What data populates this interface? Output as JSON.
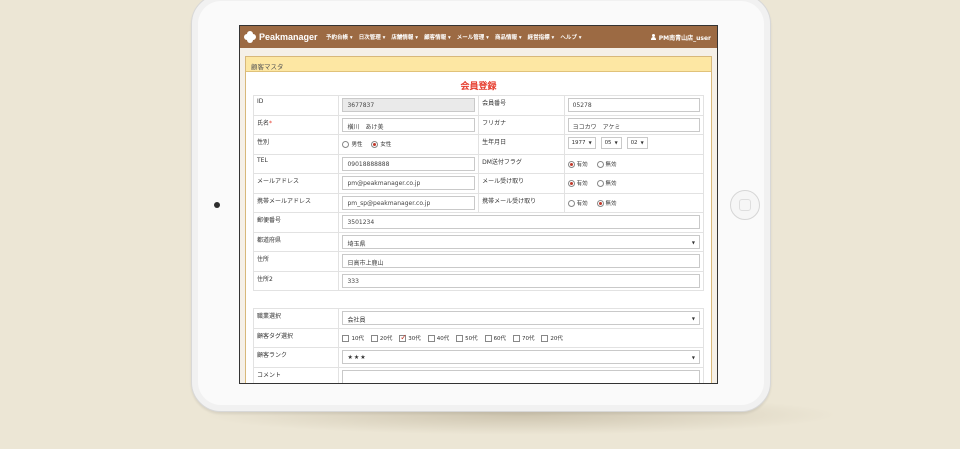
{
  "app": {
    "brand": "Peakmanager",
    "user": "PM南青山店_user"
  },
  "nav": [
    "予約台帳 ▾",
    "日次管理 ▾",
    "店舗情報 ▾",
    "顧客情報 ▾",
    "メール管理 ▾",
    "商品情報 ▾",
    "経営指標 ▾",
    "ヘルプ ▾"
  ],
  "panel": {
    "title": "顧客マスタ",
    "form_title": "会員登録"
  },
  "fields": {
    "id": {
      "label": "ID",
      "value": "3677837"
    },
    "member_no": {
      "label": "会員番号",
      "value": "05278"
    },
    "name": {
      "label": "氏名",
      "required": "*",
      "value": "横川　あけ美"
    },
    "furigana": {
      "label": "フリガナ",
      "value": "ヨコカワ　アケミ"
    },
    "gender": {
      "label": "性別",
      "options": [
        "男性",
        "女性"
      ],
      "selected": "女性"
    },
    "birthday": {
      "label": "生年月日",
      "year": "1977",
      "month": "05",
      "day": "02"
    },
    "tel": {
      "label": "TEL",
      "value": "09018888888"
    },
    "dm_flag": {
      "label": "DM送付フラグ",
      "options": [
        "有効",
        "無効"
      ],
      "selected": "有効"
    },
    "email": {
      "label": "メールアドレス",
      "value": "pm@peakmanager.co.jp"
    },
    "email_receive": {
      "label": "メール受け取り",
      "options": [
        "有効",
        "無効"
      ],
      "selected": "有効"
    },
    "mobile_email": {
      "label": "携帯メールアドレス",
      "value": "pm_sp@peakmanager.co.jp"
    },
    "mobile_receive": {
      "label": "携帯メール受け取り",
      "options": [
        "有効",
        "無効"
      ],
      "selected": "無効"
    },
    "postal": {
      "label": "郵便番号",
      "value": "3501234"
    },
    "prefecture": {
      "label": "都道府県",
      "value": "埼玉県"
    },
    "address": {
      "label": "住所",
      "value": "日高市上鹿山"
    },
    "address2": {
      "label": "住所2",
      "value": "333"
    },
    "occupation": {
      "label": "職業選択",
      "value": "会社員"
    },
    "tags": {
      "label": "顧客タグ選択",
      "options": [
        "10代",
        "20代",
        "30代",
        "40代",
        "50代",
        "60代",
        "70代",
        "20代"
      ],
      "checked": [
        2
      ]
    },
    "rank": {
      "label": "顧客ランク",
      "value": "★★★"
    },
    "comment": {
      "label": "コメント"
    }
  }
}
